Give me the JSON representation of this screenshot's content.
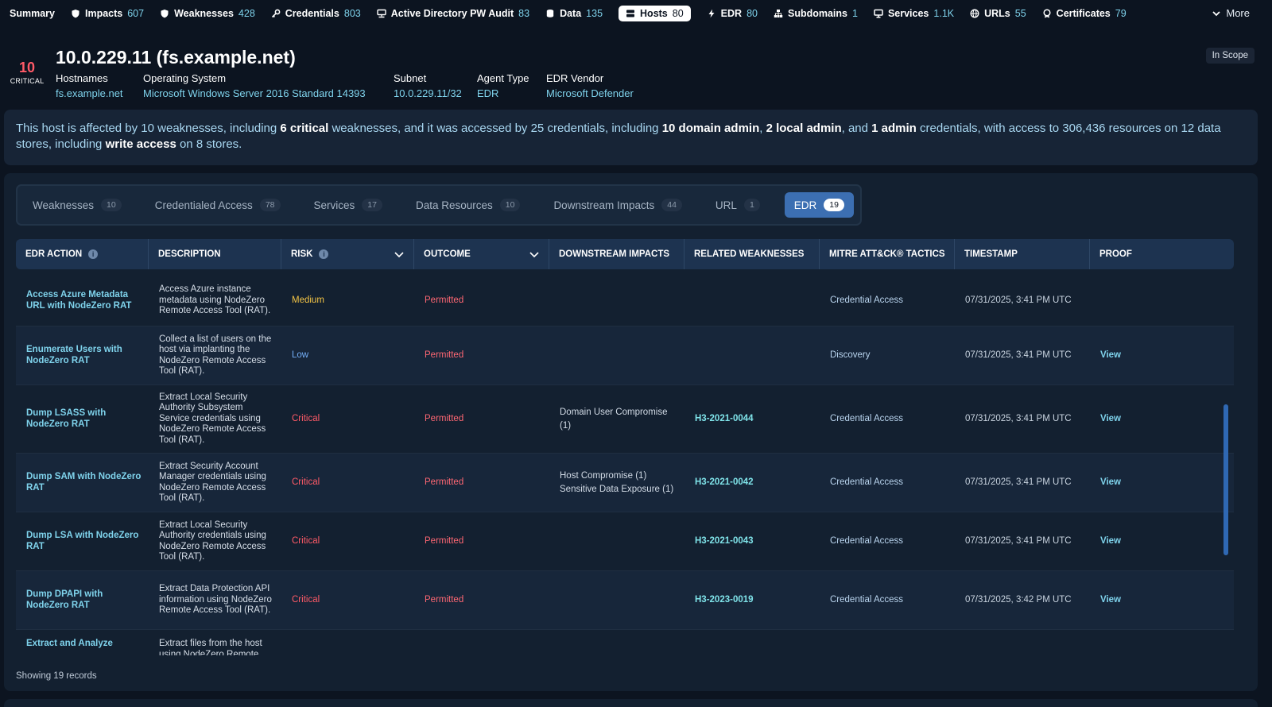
{
  "nav": {
    "items": [
      {
        "label": "Summary",
        "count": "",
        "icon": "none"
      },
      {
        "label": "Impacts",
        "count": "607",
        "icon": "shield-icon"
      },
      {
        "label": "Weaknesses",
        "count": "428",
        "icon": "shield-icon"
      },
      {
        "label": "Credentials",
        "count": "803",
        "icon": "key-icon"
      },
      {
        "label": "Active Directory PW Audit",
        "count": "83",
        "icon": "network-icon"
      },
      {
        "label": "Data",
        "count": "135",
        "icon": "database-icon"
      },
      {
        "label": "Hosts",
        "count": "80",
        "icon": "server-icon"
      },
      {
        "label": "EDR",
        "count": "80",
        "icon": "bolt-icon"
      },
      {
        "label": "Subdomains",
        "count": "1",
        "icon": "sitemap-icon"
      },
      {
        "label": "Services",
        "count": "1.1K",
        "icon": "monitor-icon"
      },
      {
        "label": "URLs",
        "count": "55",
        "icon": "globe-icon"
      },
      {
        "label": "Certificates",
        "count": "79",
        "icon": "certificate-icon"
      }
    ],
    "more_label": "More",
    "active": "Hosts"
  },
  "host": {
    "score": "10",
    "score_label": "CRITICAL",
    "title": "10.0.229.11 (fs.example.net)",
    "scope": "In Scope",
    "meta": [
      {
        "key": "Hostnames",
        "value": "fs.example.net"
      },
      {
        "key": "Operating System",
        "value": "Microsoft Windows Server 2016 Standard 14393"
      },
      {
        "key": "Subnet",
        "value": "10.0.229.11/32"
      },
      {
        "key": "Agent Type",
        "value": "EDR"
      },
      {
        "key": "EDR Vendor",
        "value": "Microsoft Defender"
      }
    ]
  },
  "summary": {
    "t1": "This host is affected by 10 weaknesses, including ",
    "b1": "6 critical",
    "t2": " weaknesses, and it was accessed by 25 credentials, including ",
    "b2": "10 domain admin",
    "t3": ", ",
    "b3": "2 local admin",
    "t4": ", and ",
    "b4": "1 admin",
    "t5": " credentials, with access to 306,436 resources on 12 data stores, including ",
    "b5": "write access",
    "t6": " on 8 stores."
  },
  "tabs": [
    {
      "label": "Weaknesses",
      "count": "10"
    },
    {
      "label": "Credentialed Access",
      "count": "78"
    },
    {
      "label": "Services",
      "count": "17"
    },
    {
      "label": "Data Resources",
      "count": "10"
    },
    {
      "label": "Downstream Impacts",
      "count": "44"
    },
    {
      "label": "URL",
      "count": "1"
    },
    {
      "label": "EDR",
      "count": "19"
    }
  ],
  "active_tab": "EDR",
  "table": {
    "columns": [
      "EDR ACTION",
      "DESCRIPTION",
      "RISK",
      "OUTCOME",
      "DOWNSTREAM IMPACTS",
      "RELATED WEAKNESSES",
      "MITRE ATT&CK® TACTICS",
      "TIMESTAMP",
      "PROOF"
    ],
    "rows": [
      {
        "action": "Access Azure Metadata URL with NodeZero RAT",
        "description": "Access Azure instance metadata using NodeZero Remote Access Tool (RAT).",
        "risk": "Medium",
        "outcome": "Permitted",
        "impacts": [],
        "weakness": "",
        "tactic": "Credential Access",
        "timestamp": "07/31/2025, 3:41 PM UTC",
        "proof": ""
      },
      {
        "action": "Enumerate Users with NodeZero RAT",
        "description": "Collect a list of users on the host via implanting the NodeZero Remote Access Tool (RAT).",
        "risk": "Low",
        "outcome": "Permitted",
        "impacts": [],
        "weakness": "",
        "tactic": "Discovery",
        "timestamp": "07/31/2025, 3:41 PM UTC",
        "proof": "View"
      },
      {
        "action": "Dump LSASS with NodeZero RAT",
        "description": "Extract Local Security Authority Subsystem Service credentials using NodeZero Remote Access Tool (RAT).",
        "risk": "Critical",
        "outcome": "Permitted",
        "impacts": [
          "Domain User Compromise (1)"
        ],
        "weakness": "H3-2021-0044",
        "tactic": "Credential Access",
        "timestamp": "07/31/2025, 3:41 PM UTC",
        "proof": "View"
      },
      {
        "action": "Dump SAM with NodeZero RAT",
        "description": "Extract Security Account Manager credentials using NodeZero Remote Access Tool (RAT).",
        "risk": "Critical",
        "outcome": "Permitted",
        "impacts": [
          "Host Compromise (1)",
          "Sensitive Data Exposure (1)"
        ],
        "weakness": "H3-2021-0042",
        "tactic": "Credential Access",
        "timestamp": "07/31/2025, 3:41 PM UTC",
        "proof": "View"
      },
      {
        "action": "Dump LSA with NodeZero RAT",
        "description": "Extract Local Security Authority credentials using NodeZero Remote Access Tool (RAT).",
        "risk": "Critical",
        "outcome": "Permitted",
        "impacts": [],
        "weakness": "H3-2021-0043",
        "tactic": "Credential Access",
        "timestamp": "07/31/2025, 3:41 PM UTC",
        "proof": "View"
      },
      {
        "action": "Dump DPAPI with NodeZero RAT",
        "description": "Extract Data Protection API information using NodeZero Remote Access Tool (RAT).",
        "risk": "Critical",
        "outcome": "Permitted",
        "impacts": [],
        "weakness": "H3-2023-0019",
        "tactic": "Credential Access",
        "timestamp": "07/31/2025, 3:42 PM UTC",
        "proof": "View"
      },
      {
        "action": "Extract and Analyze",
        "description": "Extract files from the host using NodeZero Remote",
        "risk": "",
        "outcome": "",
        "impacts": [],
        "weakness": "",
        "tactic": "",
        "timestamp": "",
        "proof": ""
      }
    ],
    "footer": "Showing 19 records"
  },
  "colors": {
    "background": "#0c1420",
    "accent": "#7fd3ec",
    "critical": "#ff5a67",
    "medium": "#f3c445",
    "low": "#74aef6",
    "active_tab": "#3c6fb2"
  }
}
